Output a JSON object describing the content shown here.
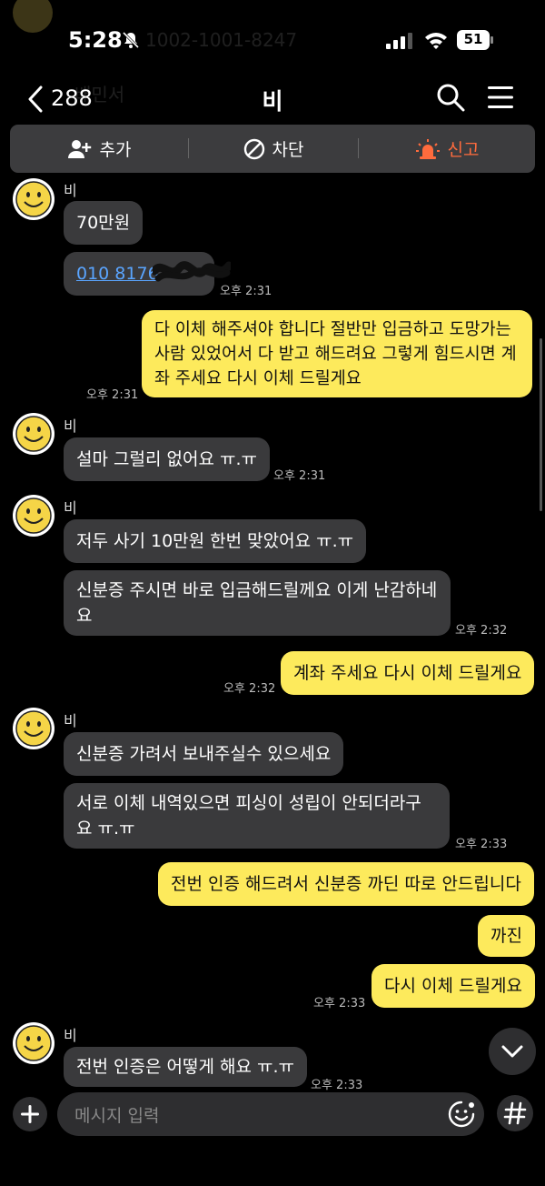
{
  "status": {
    "time": "5:28",
    "battery": "51"
  },
  "ghost": {
    "line1": "1002-1001-8247",
    "line2": "배민서"
  },
  "header": {
    "back_count": "288",
    "title": "비"
  },
  "actions": {
    "add": "추가",
    "block": "차단",
    "report": "신고"
  },
  "colors": {
    "bubble_out": "#fdea5c",
    "bubble_in": "#3a3a3c",
    "report": "#ff6b3d",
    "link": "#5aa5ff"
  },
  "messages": {
    "g1": {
      "sender": "비",
      "m1": "70만원",
      "m2": "010 8176",
      "time": "오후 2:31"
    },
    "o1": {
      "text": "다 이체 해주셔야 합니다 절반만 입금하고 도망가는 사람 있었어서 다 받고 해드려요 그렇게 힘드시면 계좌 주세요 다시 이체 드릴게요",
      "time": "오후 2:31"
    },
    "g2": {
      "sender": "비",
      "m1": "설마 그럴리 없어요 ㅠ.ㅠ",
      "time": "오후 2:31"
    },
    "g3": {
      "sender": "비",
      "m1": "저두 사기 10만원 한번 맞았어요 ㅠ.ㅠ",
      "m2": "신분증 주시면 바로 입금해드릴께요 이게 난감하네요",
      "time": "오후 2:32"
    },
    "o2": {
      "text": "계좌 주세요 다시 이체 드릴게요",
      "time": "오후 2:32"
    },
    "g4": {
      "sender": "비",
      "m1": "신분증 가려서 보내주실수 있으세요",
      "m2": "서로 이체 내역있으면 피싱이 성립이 안되더라구요 ㅠ.ㅠ",
      "time": "오후 2:33"
    },
    "o3": {
      "m1": "전번 인증 해드려서 신분증 까딘 따로 안드립니다",
      "m2": "까진",
      "m3": "다시 이체 드릴게요",
      "time": "오후 2:33"
    },
    "g5": {
      "sender": "비",
      "m1": "전번 인증은 어떻게 해요 ㅠ.ㅠ",
      "time": "오후 2:33"
    }
  },
  "input": {
    "placeholder": "메시지 입력"
  }
}
